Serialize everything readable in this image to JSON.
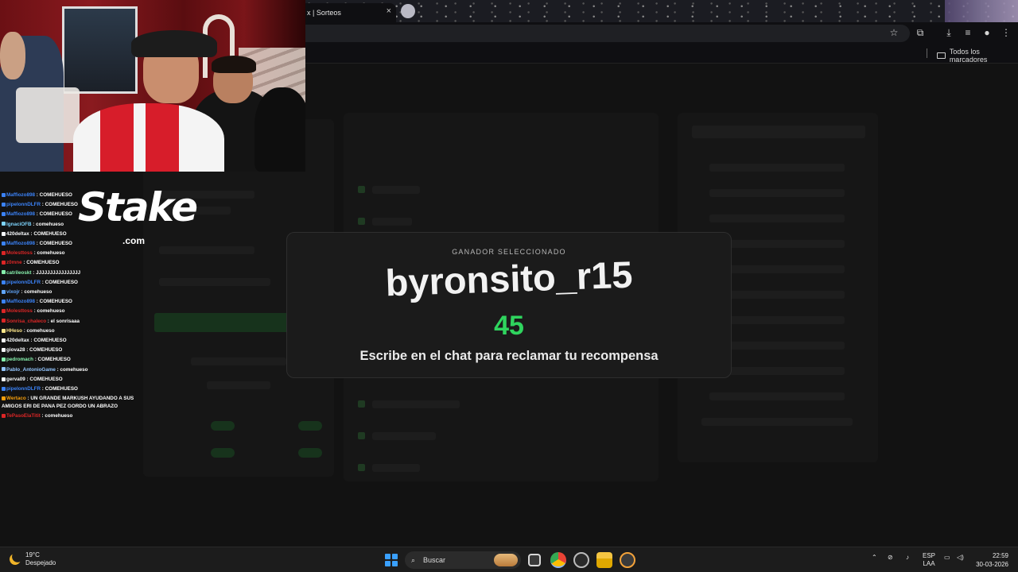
{
  "browser": {
    "tab_title": "x | Sorteos",
    "tab_close": "×",
    "bookmarks_label": "Todos los marcadores"
  },
  "overlay_logo": {
    "word": "Stake",
    "sub": ".com"
  },
  "chat": [
    {
      "user": "Maffiozo898",
      "color": "#3b82f6",
      "msg": " : COMEHUESO"
    },
    {
      "user": "pipelonnDLFR",
      "color": "#3b82f6",
      "msg": " : COMEHUESO"
    },
    {
      "user": "Maffiozo898",
      "color": "#3b82f6",
      "msg": " : COMEHUESO"
    },
    {
      "user": "IgnaciOFB",
      "color": "#7dd3fc",
      "msg": " : comehueso"
    },
    {
      "user": "420deltax",
      "color": "#f8fafc",
      "msg": " : COMEHUESO"
    },
    {
      "user": "Maffiozo898",
      "color": "#3b82f6",
      "msg": " : COMEHUESO"
    },
    {
      "user": "Molesttoss",
      "color": "#dc2626",
      "msg": " : comehueso"
    },
    {
      "user": "z0mne",
      "color": "#dc2626",
      "msg": " : COMEHUESO"
    },
    {
      "user": "catrileoskt",
      "color": "#86efac",
      "msg": " : JJJJJJJJJJJJJJJJ"
    },
    {
      "user": "pipelonnDLFR",
      "color": "#3b82f6",
      "msg": " : COMEHUESO"
    },
    {
      "user": "vixojr",
      "color": "#60a5fa",
      "msg": " : comehueso"
    },
    {
      "user": "Maffiozo898",
      "color": "#3b82f6",
      "msg": " : COMEHUESO"
    },
    {
      "user": "Molesttoss",
      "color": "#dc2626",
      "msg": " : comehueso"
    },
    {
      "user": "Sonrisa_chaleco",
      "color": "#dc2626",
      "msg": " : el sonrisaaa"
    },
    {
      "user": "HHeso",
      "color": "#fde68a",
      "msg": " : comehueso"
    },
    {
      "user": "420deltax",
      "color": "#f8fafc",
      "msg": " : COMEHUESO"
    },
    {
      "user": "giova28",
      "color": "#f8fafc",
      "msg": " : COMEHUESO"
    },
    {
      "user": "pedromach",
      "color": "#86efac",
      "msg": " : COMEHUESO"
    },
    {
      "user": "Pablo_AntonioGame",
      "color": "#93c5fd",
      "msg": " : comehueso"
    },
    {
      "user": "gerva09",
      "color": "#f8fafc",
      "msg": " : COMEHUESO"
    },
    {
      "user": "pipelonnDLFR",
      "color": "#3b82f6",
      "msg": " : COMEHUESO"
    },
    {
      "user": "Wertaco",
      "color": "#f59e0b",
      "msg": " : UN GRANDE MARKUSH AYUDANDO A SUS AMIGOS ERI DE PANA PEZ GORDO UN ABRAZO"
    },
    {
      "user": "TePasoElaTitit",
      "color": "#dc2626",
      "msg": " : comehueso"
    }
  ],
  "winner_modal": {
    "label": "GANADOR SELECCIONADO",
    "winner": "byronsito_r15",
    "number": "45",
    "instruction": "Escribe en el chat para reclamar tu recompensa"
  },
  "taskbar": {
    "weather_temp": "19°C",
    "weather_desc": "Despejado",
    "search_placeholder": "Buscar",
    "lang_top": "ESP",
    "lang_bottom": "LAA",
    "time": "22:59",
    "date": "30-03-2026"
  },
  "colors": {
    "accent_green": "#2fd45e",
    "windows_blue": "#3aa0ff"
  }
}
